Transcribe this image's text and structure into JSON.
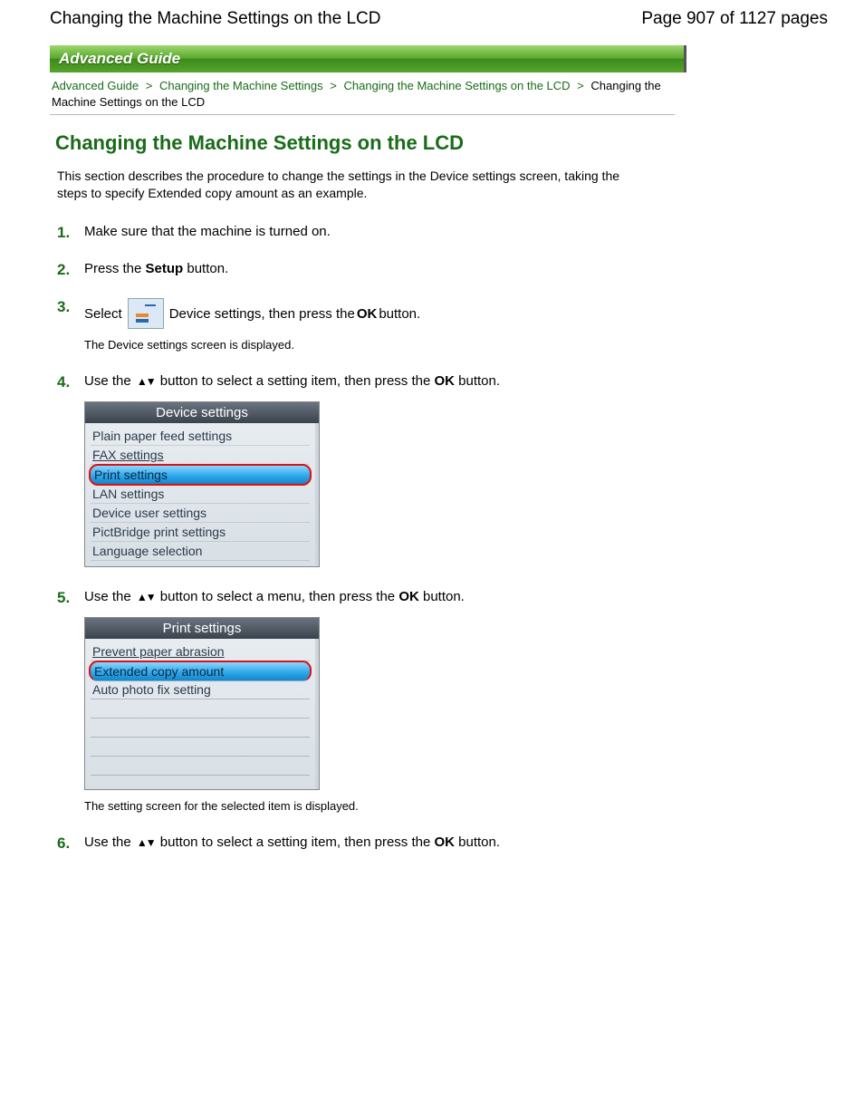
{
  "header": {
    "left": "Changing the Machine Settings on the LCD",
    "right": "Page 907 of 1127 pages"
  },
  "bar": {
    "label": "Advanced Guide"
  },
  "breadcrumb": {
    "a": "Advanced Guide",
    "b": "Changing the Machine Settings",
    "c": "Changing the Machine Settings on the LCD",
    "d": "Changing the Machine Settings on the LCD",
    "sep": ">"
  },
  "title": "Changing the Machine Settings on the LCD",
  "intro": "This section describes the procedure to change the settings in the Device settings screen, taking the steps to specify Extended copy amount as an example.",
  "steps": {
    "s1": "Make sure that the machine is turned on.",
    "s2a": "Press the ",
    "s2b": "Setup",
    "s2c": " button.",
    "s3a": "Select ",
    "s3b": " Device settings, then press the ",
    "s3ok": "OK",
    "s3c": " button.",
    "s3sub": "The Device settings screen is displayed.",
    "s4a": "Use the ",
    "s4b": " button to select a setting item, then press the ",
    "s4ok": "OK",
    "s4c": " button.",
    "s5a": "Use the ",
    "s5b": " button to select a menu, then press the ",
    "s5ok": "OK",
    "s5c": " button.",
    "s5sub": "The setting screen for the selected item is displayed.",
    "s6a": "Use the ",
    "s6b": " button to select a setting item, then press the ",
    "s6ok": "OK",
    "s6c": " button."
  },
  "lcd1": {
    "title": "Device settings",
    "items": [
      {
        "label": "Plain paper feed settings",
        "selected": false,
        "underlined": false
      },
      {
        "label": "FAX settings",
        "selected": false,
        "underlined": true
      },
      {
        "label": "Print settings",
        "selected": true,
        "underlined": false
      },
      {
        "label": "LAN settings",
        "selected": false,
        "underlined": false
      },
      {
        "label": "Device user settings",
        "selected": false,
        "underlined": false
      },
      {
        "label": "PictBridge print settings",
        "selected": false,
        "underlined": false
      },
      {
        "label": "Language selection",
        "selected": false,
        "underlined": false
      }
    ]
  },
  "lcd2": {
    "title": "Print settings",
    "items": [
      {
        "label": "Prevent paper abrasion",
        "selected": false,
        "underlined": true
      },
      {
        "label": "Extended copy amount",
        "selected": true,
        "underlined": false
      },
      {
        "label": "Auto photo fix setting",
        "selected": false,
        "underlined": false
      },
      {
        "label": "",
        "selected": false,
        "underlined": false
      },
      {
        "label": "",
        "selected": false,
        "underlined": false
      },
      {
        "label": "",
        "selected": false,
        "underlined": false
      },
      {
        "label": "",
        "selected": false,
        "underlined": false
      }
    ]
  },
  "arrows": "▲▼"
}
